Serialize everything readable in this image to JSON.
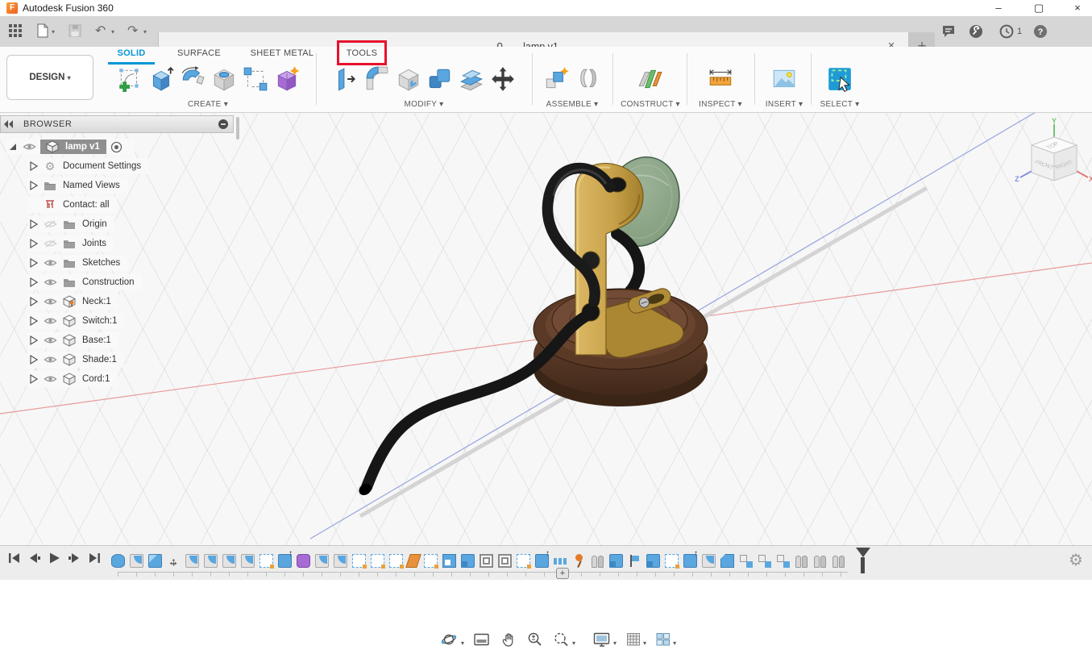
{
  "window": {
    "logo": "F",
    "title": "Autodesk Fusion 360",
    "minimize": "–",
    "maximize": "▢",
    "close": "×"
  },
  "glyphs": {
    "dropdown": "▾",
    "undo": "↶",
    "redo": "↷",
    "gear": "⚙",
    "help": "?",
    "plus": "+",
    "close": "×"
  },
  "doc_tab": {
    "label": "lamp v1",
    "locked": true
  },
  "top_right_icons": [
    "comments",
    "job-status",
    "notifications",
    "help"
  ],
  "notifications_count": "1",
  "workspace": {
    "label": "DESIGN"
  },
  "ribbon": {
    "accent_color": "#0696d7",
    "highlight_color": "#e8112d",
    "tabs": [
      {
        "label": "SOLID",
        "active": true
      },
      {
        "label": "SURFACE",
        "active": false
      },
      {
        "label": "SHEET METAL",
        "active": false
      },
      {
        "label": "TOOLS",
        "active": false,
        "highlighted": true
      }
    ],
    "groups": [
      {
        "label": "CREATE",
        "icons": [
          "create-sketch",
          "extrude",
          "revolve",
          "hole",
          "pattern",
          "create-form"
        ]
      },
      {
        "label": "MODIFY",
        "icons": [
          "press-pull",
          "fillet",
          "shell",
          "combine",
          "offset-face",
          "move"
        ]
      },
      {
        "label": "ASSEMBLE",
        "icons": [
          "new-component",
          "joint"
        ]
      },
      {
        "label": "CONSTRUCT",
        "icons": [
          "construction-plane"
        ]
      },
      {
        "label": "INSPECT",
        "icons": [
          "measure"
        ]
      },
      {
        "label": "INSERT",
        "icons": [
          "canvas"
        ]
      },
      {
        "label": "SELECT",
        "icons": [
          "select"
        ]
      }
    ]
  },
  "browser": {
    "title": "BROWSER",
    "items": [
      {
        "label": "lamp v1",
        "icon": "component-assembly",
        "selected": true,
        "visible": true,
        "activated": true
      },
      {
        "label": "Document Settings",
        "icon": "gear"
      },
      {
        "label": "Named Views",
        "icon": "folder"
      },
      {
        "label": "Contact: all",
        "icon": "contact-sets"
      },
      {
        "label": "Origin",
        "icon": "folder",
        "visible": false
      },
      {
        "label": "Joints",
        "icon": "folder",
        "visible": false
      },
      {
        "label": "Sketches",
        "icon": "folder",
        "visible": true
      },
      {
        "label": "Construction",
        "icon": "folder",
        "visible": true
      },
      {
        "label": "Neck:1",
        "icon": "component-grounded",
        "visible": true
      },
      {
        "label": "Switch:1",
        "icon": "component",
        "visible": true
      },
      {
        "label": "Base:1",
        "icon": "component",
        "visible": true
      },
      {
        "label": "Shade:1",
        "icon": "component",
        "visible": true
      },
      {
        "label": "Cord:1",
        "icon": "component",
        "visible": true
      }
    ]
  },
  "viewcube": {
    "faces": {
      "top": "TOP",
      "front": "FRONT",
      "right": "RIGHT"
    },
    "axes": [
      {
        "label": "X",
        "color": "#e07a7a"
      },
      {
        "label": "Y",
        "color": "#74c274"
      },
      {
        "label": "Z",
        "color": "#8392dd"
      }
    ]
  },
  "viewport": {
    "model": "desk lamp assembly",
    "materials": {
      "bracket": "#c8a24a",
      "base": "#5d3a27",
      "shade": "#8ca68a",
      "cord": "#1c1c1c"
    },
    "axis_x_color": "#e89a9a",
    "axis_z_color": "#97a4e0"
  },
  "nav_bar": {
    "tools": [
      "orbit",
      "look-at",
      "pan",
      "zoom",
      "fit",
      "display-settings",
      "grid-settings",
      "viewports"
    ]
  },
  "timeline": {
    "playback": [
      "go-to-start",
      "step-back",
      "play",
      "step-forward",
      "go-to-end"
    ],
    "features": [
      "cylinder",
      "revolve",
      "box",
      "move",
      "revolve",
      "revolve",
      "fillet",
      "fillet",
      "sketch",
      "extrude",
      "form",
      "fillet",
      "fillet",
      "sketch",
      "sketch",
      "sketch",
      "plane",
      "sketch",
      "cut",
      "combine",
      "shell",
      "shell",
      "sketch",
      "extrude",
      "holes",
      "pin",
      "joint",
      "combine",
      "flag",
      "combine",
      "sketch",
      "extrude",
      "fillet",
      "chamfer",
      "copy",
      "copy",
      "copy",
      "joint",
      "joint",
      "joint"
    ],
    "zoom_handle": "+"
  }
}
